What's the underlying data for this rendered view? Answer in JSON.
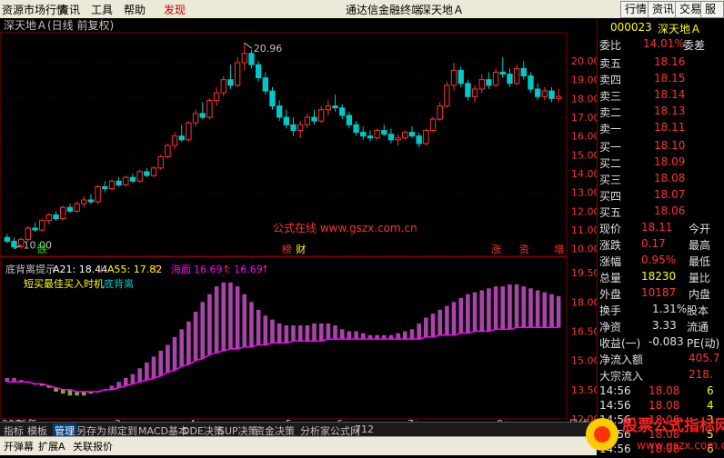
{
  "menu": {
    "items": [
      "资源市场行情",
      "资讯",
      "工具",
      "帮助",
      "发现"
    ],
    "center_title": "通达信金融终端",
    "stock_title": "深天地Ａ",
    "right_buttons": [
      "行情",
      "资讯",
      "交易",
      "服务"
    ]
  },
  "chart_header": {
    "title": "深天地Ａ(日线 前复权)",
    "high_label": "20.96",
    "low_label": "10.00",
    "watermark": "公式在线 www.gszx.com.cn",
    "events": [
      "跌",
      "榜",
      "财",
      "涨",
      "资",
      "增"
    ]
  },
  "indicator_header": {
    "name": "底背离提示",
    "a21_label": "A21: 18.44",
    "a21_arrow": "↓",
    "a55_label": "A55: 17.82",
    "a55_arrow": "↑",
    "sea_label": "海面",
    "sea_val1": "16.69",
    "sea_arrow": "↑",
    "sea_val2": ": 16.69",
    "sea_arrow2": "↑",
    "legend_buy": "短买最佳买入时机",
    "legend_div": "底背离"
  },
  "axes": {
    "price_ticks": [
      "20.00",
      "19.00",
      "18.00",
      "17.00",
      "16.00",
      "15.00",
      "14.00",
      "13.00",
      "12.00",
      "11.00",
      "10.00"
    ],
    "ind_ticks": [
      "19.50",
      "18.00",
      "16.50",
      "15.00",
      "13.50",
      "12.00"
    ],
    "x_labels": [
      "2020年",
      "2",
      "3",
      "4",
      "5",
      "6",
      "7",
      "8"
    ],
    "x_unit": "日线"
  },
  "chart_data": {
    "type": "candlestick",
    "price_range": [
      9.6,
      21.5
    ],
    "ohlc": [
      [
        10.6,
        10.8,
        10.3,
        10.4
      ],
      [
        10.4,
        10.6,
        10.0,
        10.1
      ],
      [
        10.1,
        10.6,
        10.0,
        10.5
      ],
      [
        10.5,
        11.2,
        10.4,
        11.1
      ],
      [
        11.1,
        11.4,
        10.9,
        11.0
      ],
      [
        11.0,
        11.6,
        10.9,
        11.5
      ],
      [
        11.5,
        11.9,
        11.3,
        11.8
      ],
      [
        11.8,
        12.0,
        11.5,
        11.6
      ],
      [
        11.6,
        12.3,
        11.5,
        12.2
      ],
      [
        12.2,
        12.4,
        11.9,
        12.0
      ],
      [
        12.0,
        12.5,
        11.9,
        12.4
      ],
      [
        12.4,
        12.8,
        12.2,
        12.6
      ],
      [
        12.6,
        12.9,
        12.4,
        12.5
      ],
      [
        12.5,
        13.4,
        12.4,
        13.3
      ],
      [
        13.3,
        13.6,
        13.0,
        13.2
      ],
      [
        13.2,
        13.7,
        13.1,
        13.6
      ],
      [
        13.6,
        13.8,
        13.3,
        13.4
      ],
      [
        13.4,
        13.9,
        13.3,
        13.8
      ],
      [
        13.8,
        14.0,
        13.5,
        13.6
      ],
      [
        13.6,
        14.2,
        13.5,
        14.1
      ],
      [
        14.1,
        14.3,
        13.8,
        13.9
      ],
      [
        13.9,
        14.4,
        13.8,
        14.3
      ],
      [
        14.3,
        15.0,
        14.2,
        14.9
      ],
      [
        14.9,
        15.6,
        14.8,
        15.5
      ],
      [
        15.5,
        16.2,
        15.3,
        16.0
      ],
      [
        16.0,
        16.6,
        15.7,
        15.8
      ],
      [
        15.8,
        16.8,
        15.7,
        16.7
      ],
      [
        16.7,
        17.4,
        16.5,
        17.2
      ],
      [
        17.2,
        17.8,
        16.9,
        17.0
      ],
      [
        17.0,
        18.0,
        16.9,
        17.9
      ],
      [
        17.9,
        18.6,
        17.6,
        18.3
      ],
      [
        18.3,
        19.2,
        18.1,
        19.0
      ],
      [
        19.0,
        19.8,
        18.5,
        18.7
      ],
      [
        18.7,
        20.2,
        18.6,
        19.9
      ],
      [
        19.9,
        20.96,
        19.5,
        20.4
      ],
      [
        20.4,
        20.6,
        19.6,
        19.8
      ],
      [
        19.8,
        20.0,
        18.9,
        19.1
      ],
      [
        19.1,
        19.4,
        18.2,
        18.4
      ],
      [
        18.4,
        18.6,
        17.4,
        17.6
      ],
      [
        17.6,
        17.9,
        16.8,
        17.0
      ],
      [
        17.0,
        17.4,
        16.4,
        16.6
      ],
      [
        16.6,
        17.0,
        16.0,
        16.3
      ],
      [
        16.3,
        16.8,
        15.9,
        16.6
      ],
      [
        16.6,
        17.2,
        16.4,
        17.0
      ],
      [
        17.0,
        17.4,
        16.6,
        16.8
      ],
      [
        16.8,
        17.6,
        16.7,
        17.4
      ],
      [
        17.4,
        17.9,
        17.1,
        17.6
      ],
      [
        17.6,
        18.2,
        17.3,
        17.5
      ],
      [
        17.5,
        17.7,
        16.9,
        17.1
      ],
      [
        17.1,
        17.3,
        16.4,
        16.6
      ],
      [
        16.6,
        16.8,
        16.0,
        16.2
      ],
      [
        16.2,
        16.5,
        15.8,
        16.0
      ],
      [
        16.0,
        16.3,
        15.7,
        15.9
      ],
      [
        15.9,
        16.4,
        15.8,
        16.3
      ],
      [
        16.3,
        16.6,
        16.0,
        16.1
      ],
      [
        16.1,
        16.4,
        15.6,
        15.8
      ],
      [
        15.8,
        16.1,
        15.5,
        15.9
      ],
      [
        15.9,
        16.3,
        15.8,
        16.2
      ],
      [
        16.2,
        16.5,
        15.9,
        16.0
      ],
      [
        16.0,
        16.2,
        15.4,
        15.6
      ],
      [
        15.6,
        16.4,
        15.5,
        16.3
      ],
      [
        16.3,
        17.0,
        16.2,
        16.9
      ],
      [
        16.9,
        17.8,
        16.8,
        17.6
      ],
      [
        17.6,
        18.9,
        17.5,
        18.7
      ],
      [
        18.7,
        19.9,
        18.4,
        19.5
      ],
      [
        19.5,
        19.7,
        18.6,
        18.8
      ],
      [
        18.8,
        19.0,
        17.9,
        18.1
      ],
      [
        18.1,
        18.7,
        17.8,
        18.5
      ],
      [
        18.5,
        19.3,
        18.3,
        19.0
      ],
      [
        19.0,
        19.4,
        18.5,
        18.7
      ],
      [
        18.7,
        19.6,
        18.6,
        19.4
      ],
      [
        19.4,
        20.2,
        19.1,
        19.3
      ],
      [
        19.3,
        19.6,
        18.6,
        18.8
      ],
      [
        18.8,
        19.8,
        18.7,
        19.6
      ],
      [
        19.6,
        20.0,
        19.0,
        19.2
      ],
      [
        19.2,
        19.4,
        18.3,
        18.5
      ],
      [
        18.5,
        18.8,
        17.9,
        18.1
      ],
      [
        18.1,
        18.6,
        17.9,
        18.4
      ],
      [
        18.4,
        18.6,
        17.8,
        18.0
      ],
      [
        18.0,
        18.5,
        17.8,
        18.11
      ]
    ],
    "indicator_range": [
      12.0,
      20.3
    ],
    "bars_top": [
      14.1,
      14.1,
      14.0,
      13.9,
      13.8,
      13.7,
      13.6,
      13.4,
      13.3,
      13.2,
      13.2,
      13.2,
      13.3,
      13.4,
      13.5,
      13.7,
      13.9,
      14.1,
      14.3,
      14.6,
      14.9,
      15.2,
      15.5,
      15.8,
      16.2,
      16.6,
      17.0,
      17.5,
      18.0,
      18.4,
      18.8,
      19.0,
      19.0,
      18.8,
      18.4,
      18.0,
      17.6,
      17.3,
      17.1,
      16.9,
      16.8,
      16.8,
      16.8,
      16.8,
      16.9,
      16.9,
      16.9,
      16.8,
      16.6,
      16.5,
      16.5,
      16.4,
      16.3,
      16.3,
      16.3,
      16.3,
      16.4,
      16.5,
      16.6,
      16.9,
      17.2,
      17.4,
      17.6,
      17.8,
      18.0,
      18.2,
      18.4,
      18.5,
      18.6,
      18.7,
      18.8,
      18.8,
      18.9,
      18.9,
      18.8,
      18.7,
      18.6,
      18.5,
      18.4,
      18.3
    ],
    "line_a55": [
      13.9,
      13.9,
      13.9,
      13.9,
      13.8,
      13.8,
      13.7,
      13.6,
      13.5,
      13.5,
      13.4,
      13.4,
      13.4,
      13.4,
      13.5,
      13.5,
      13.6,
      13.7,
      13.8,
      13.9,
      14.0,
      14.1,
      14.2,
      14.4,
      14.5,
      14.7,
      14.8,
      15.0,
      15.1,
      15.3,
      15.4,
      15.5,
      15.6,
      15.6,
      15.7,
      15.7,
      15.8,
      15.8,
      15.9,
      15.9,
      15.9,
      16.0,
      16.0,
      16.0,
      16.0,
      16.0,
      16.1,
      16.1,
      16.1,
      16.1,
      16.1,
      16.1,
      16.1,
      16.1,
      16.1,
      16.1,
      16.1,
      16.1,
      16.1,
      16.1,
      16.2,
      16.2,
      16.3,
      16.3,
      16.3,
      16.4,
      16.4,
      16.5,
      16.5,
      16.5,
      16.6,
      16.6,
      16.6,
      16.7,
      16.7,
      16.7,
      16.7,
      16.7,
      16.7,
      16.69
    ]
  },
  "quote": {
    "code": "000023",
    "name": "深天地Ａ",
    "webi_label": "委比",
    "webi_value": "14.01%",
    "weica_label": "委差",
    "asks": [
      {
        "label": "卖五",
        "price": "18.16"
      },
      {
        "label": "卖四",
        "price": "18.15"
      },
      {
        "label": "卖三",
        "price": "18.14"
      },
      {
        "label": "卖二",
        "price": "18.13"
      },
      {
        "label": "卖一",
        "price": "18.11"
      }
    ],
    "bids": [
      {
        "label": "买一",
        "price": "18.10"
      },
      {
        "label": "买二",
        "price": "18.09"
      },
      {
        "label": "买三",
        "price": "18.08"
      },
      {
        "label": "买四",
        "price": "18.07"
      },
      {
        "label": "买五",
        "price": "18.06"
      }
    ],
    "stats": [
      {
        "l": "现价",
        "v": "18.11",
        "r": "今开"
      },
      {
        "l": "涨跌",
        "v": "0.17",
        "r": "最高"
      },
      {
        "l": "涨幅",
        "v": "0.95%",
        "r": "最低"
      },
      {
        "l": "总量",
        "v": "18230",
        "r": "量比"
      },
      {
        "l": "外盘",
        "v": "10187",
        "r": "内盘"
      }
    ],
    "stats2": [
      {
        "l": "换手",
        "v": "1.31%",
        "r": "股本"
      },
      {
        "l": "净资",
        "v": "3.33",
        "r": "流通"
      },
      {
        "l": "收益(一)",
        "v": "-0.083",
        "r": "PE(动)"
      }
    ],
    "flow": [
      {
        "l": "净流入额",
        "v": "405.7"
      },
      {
        "l": "大宗流入",
        "v": "218."
      }
    ],
    "ticks": [
      {
        "t": "14:56",
        "p": "18.08",
        "v": "6"
      },
      {
        "t": "14:56",
        "p": "18.08",
        "v": "4"
      },
      {
        "t": "14:56",
        "p": "18.06",
        "v": "3"
      },
      {
        "t": "14:56",
        "p": "18.08",
        "v": "5"
      },
      {
        "t": "14:56",
        "p": "18.08",
        "v": "6"
      }
    ]
  },
  "tabs": [
    "指标",
    "模板",
    "管理",
    "另存为",
    "绑定到",
    "MACD基本",
    "DDE决策",
    "SUP决策",
    "资金决策",
    "分析家公式网",
    "712"
  ],
  "bottom": [
    "开弹幕",
    "扩展A",
    "关联报价"
  ],
  "logo_text": "股票公式指标网",
  "logo_url": "www.gszx.com.cn",
  "colors": {
    "up": "#ff3232",
    "down": "#00c8c8",
    "a55": "#ff00ff",
    "bars": "#c850c8",
    "bars_low": "#9acd32"
  }
}
